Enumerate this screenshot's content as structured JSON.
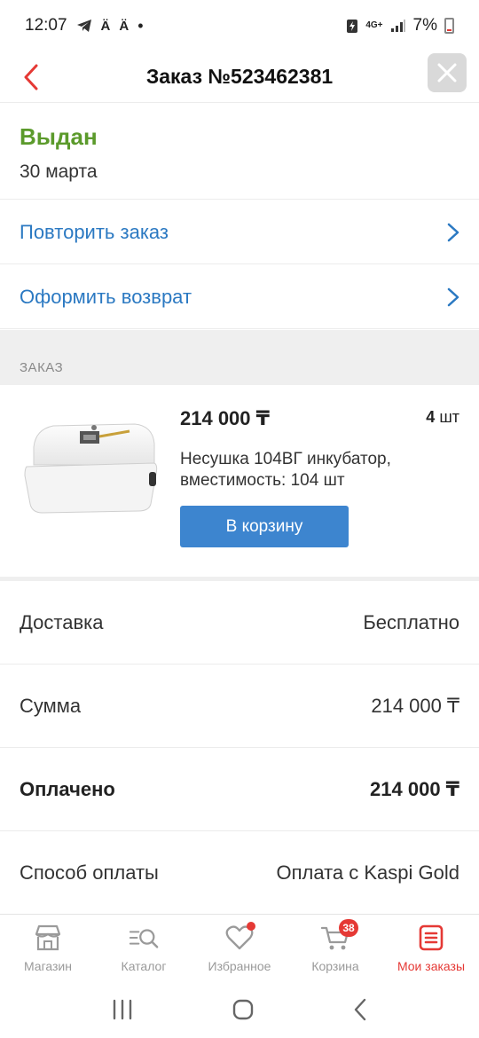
{
  "status_bar": {
    "time": "12:07",
    "network": "4G+",
    "battery": "7%"
  },
  "header": {
    "title": "Заказ №523462381"
  },
  "order_status": {
    "status": "Выдан",
    "date": "30 марта"
  },
  "actions": [
    {
      "label": "Повторить заказ"
    },
    {
      "label": "Оформить возврат"
    }
  ],
  "section_title": "ЗАКАЗ",
  "product": {
    "price": "214 000 ₸",
    "qty_number": "4",
    "qty_unit": "шт",
    "name": "Несушка 104ВГ инкубатор, вместимость: 104 шт",
    "cart_button": "В корзину"
  },
  "summary": [
    {
      "label": "Доставка",
      "value": "Бесплатно"
    },
    {
      "label": "Сумма",
      "value": "214 000 ₸"
    },
    {
      "label": "Оплачено",
      "value": "214 000 ₸"
    },
    {
      "label": "Способ оплаты",
      "value": "Оплата с Kaspi Gold"
    }
  ],
  "tabs": [
    {
      "label": "Магазин",
      "icon": "shop-icon"
    },
    {
      "label": "Каталог",
      "icon": "catalog-search-icon"
    },
    {
      "label": "Избранное",
      "icon": "heart-icon"
    },
    {
      "label": "Корзина",
      "icon": "cart-icon",
      "badge": "38"
    },
    {
      "label": "Мои заказы",
      "icon": "orders-icon"
    }
  ],
  "colors": {
    "accent_red": "#e53935",
    "link_blue": "#2b79c2",
    "status_green": "#5b9a2b",
    "button_blue": "#3d85cf"
  }
}
